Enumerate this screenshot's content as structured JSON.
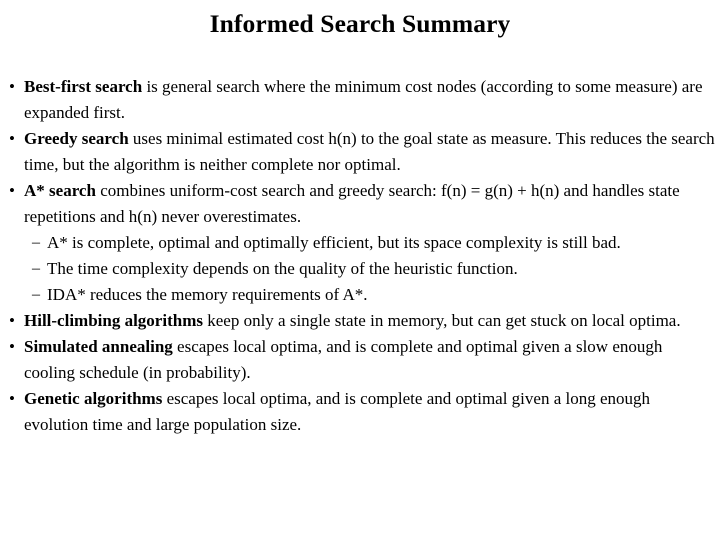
{
  "slide": {
    "title": "Informed Search Summary",
    "bullet_glyph": "•",
    "subbullet_glyph": "–",
    "text_color": "#000000",
    "background_color": "#ffffff",
    "items": [
      {
        "level": 1,
        "lead": "Best-first search",
        "rest": " is general search where the minimum cost nodes (according to some measure) are expanded first."
      },
      {
        "level": 1,
        "lead": "Greedy search",
        "rest": " uses minimal estimated cost h(n) to the goal state as measure. This reduces the search time, but the algorithm is neither complete nor optimal."
      },
      {
        "level": 1,
        "lead": "A* search",
        "rest": " combines uniform-cost search and greedy search: f(n) = g(n) + h(n) and handles state repetitions and h(n) never overestimates."
      },
      {
        "level": 2,
        "lead": "",
        "rest": "A* is complete, optimal and optimally efficient, but its space complexity is still bad."
      },
      {
        "level": 2,
        "lead": "",
        "rest": "The time complexity depends on the quality of the heuristic function."
      },
      {
        "level": 2,
        "lead": "",
        "rest": "IDA* reduces the memory requirements of A*."
      },
      {
        "level": 1,
        "lead": "Hill-climbing algorithms",
        "rest": " keep only a single state in memory, but can get stuck on local optima."
      },
      {
        "level": 1,
        "lead": "Simulated annealing",
        "rest": " escapes local optima, and is complete and optimal given a slow enough cooling schedule (in probability)."
      },
      {
        "level": 1,
        "lead": "Genetic algorithms",
        "rest": " escapes local optima, and is complete and optimal given a long enough evolution time and large population size."
      }
    ]
  }
}
